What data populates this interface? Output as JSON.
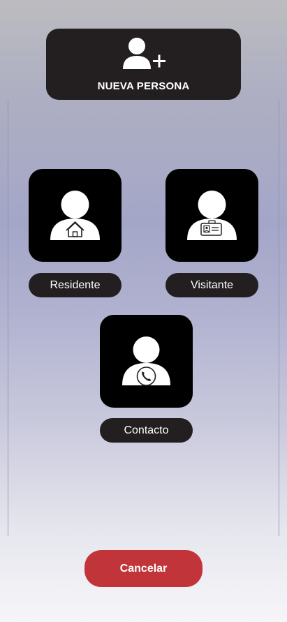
{
  "header": {
    "icon": "add-person-icon",
    "title": "NUEVA PERSONA"
  },
  "options": [
    {
      "label": "Residente",
      "icon": "resident-home-icon"
    },
    {
      "label": "Visitante",
      "icon": "visitor-badge-icon"
    },
    {
      "label": "Contacto",
      "icon": "contact-phone-icon"
    }
  ],
  "footer": {
    "cancel_label": "Cancelar"
  },
  "colors": {
    "card": "#231f20",
    "tile": "#000000",
    "cancel": "#c1353a"
  }
}
